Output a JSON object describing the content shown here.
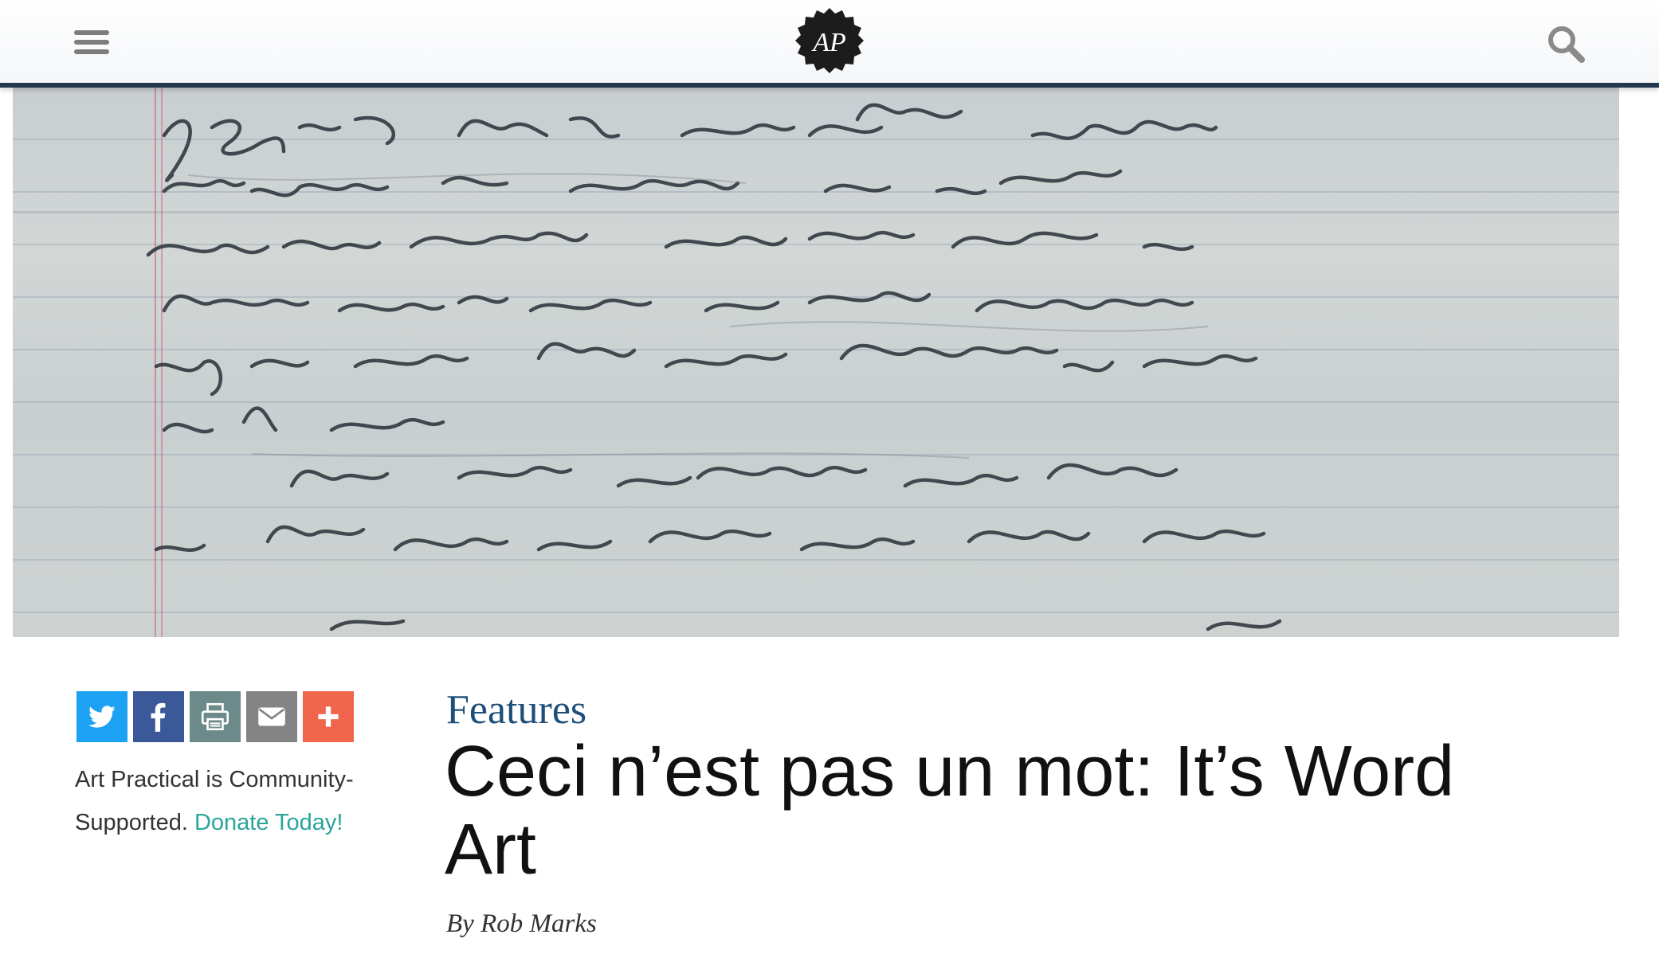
{
  "header": {
    "logo_text": "AP",
    "menu_icon": "hamburger-menu-icon",
    "search_icon": "search-icon",
    "accent_color": "#24384d"
  },
  "hero_image": {
    "icon": "handwritten-letter-photo"
  },
  "share": {
    "buttons": [
      {
        "name": "twitter",
        "icon": "twitter-icon",
        "color": "#1da1f2"
      },
      {
        "name": "facebook",
        "icon": "facebook-icon",
        "color": "#3b5998"
      },
      {
        "name": "print",
        "icon": "print-icon",
        "color": "#6d8a8a"
      },
      {
        "name": "email",
        "icon": "email-icon",
        "color": "#848484"
      },
      {
        "name": "more",
        "icon": "plus-icon",
        "color": "#f0654b"
      }
    ]
  },
  "sidebar": {
    "support_text": "Art Practical is Community-Supported.",
    "donate_label": "Donate Today!",
    "donate_color": "#2aa59a"
  },
  "article": {
    "category": "Features",
    "title": "Ceci n’est pas un mot: It’s Word Art",
    "byline_prefix": "By",
    "author": "Rob Marks"
  }
}
